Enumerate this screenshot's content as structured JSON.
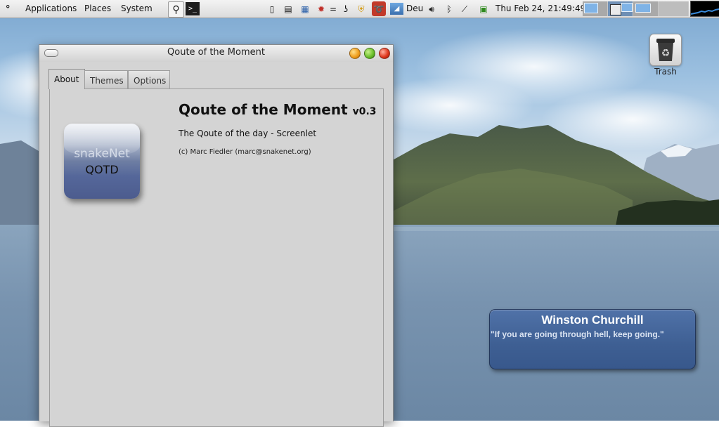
{
  "panel": {
    "menus": [
      "Applications",
      "Places",
      "System"
    ],
    "keyboard_layout": "Deu",
    "clock": "Thu Feb 24, 21:49:49",
    "workspaces": 4,
    "active_workspace": 2
  },
  "window": {
    "title": "Qoute of the Moment",
    "tabs": [
      {
        "label": "About",
        "active": true
      },
      {
        "label": "Themes",
        "active": false
      },
      {
        "label": "Options",
        "active": false
      }
    ],
    "about": {
      "app_name": "Qoute of the Moment",
      "version": "v0.3",
      "description": "The Qoute of the day - Screenlet",
      "copyright": "(c) Marc Fiedler (marc@snakenet.org)",
      "icon_line1": "snakeNet",
      "icon_line2": "QOTD"
    }
  },
  "desktop": {
    "trash_label": "Trash"
  },
  "quote": {
    "author": "Winston Churchill",
    "text": "\"If you are going through hell, keep going.\""
  },
  "colors": {
    "quote_bg": "#4266a0",
    "window_bg": "#d4d4d4",
    "panel_bg": "#e4e4e4"
  }
}
